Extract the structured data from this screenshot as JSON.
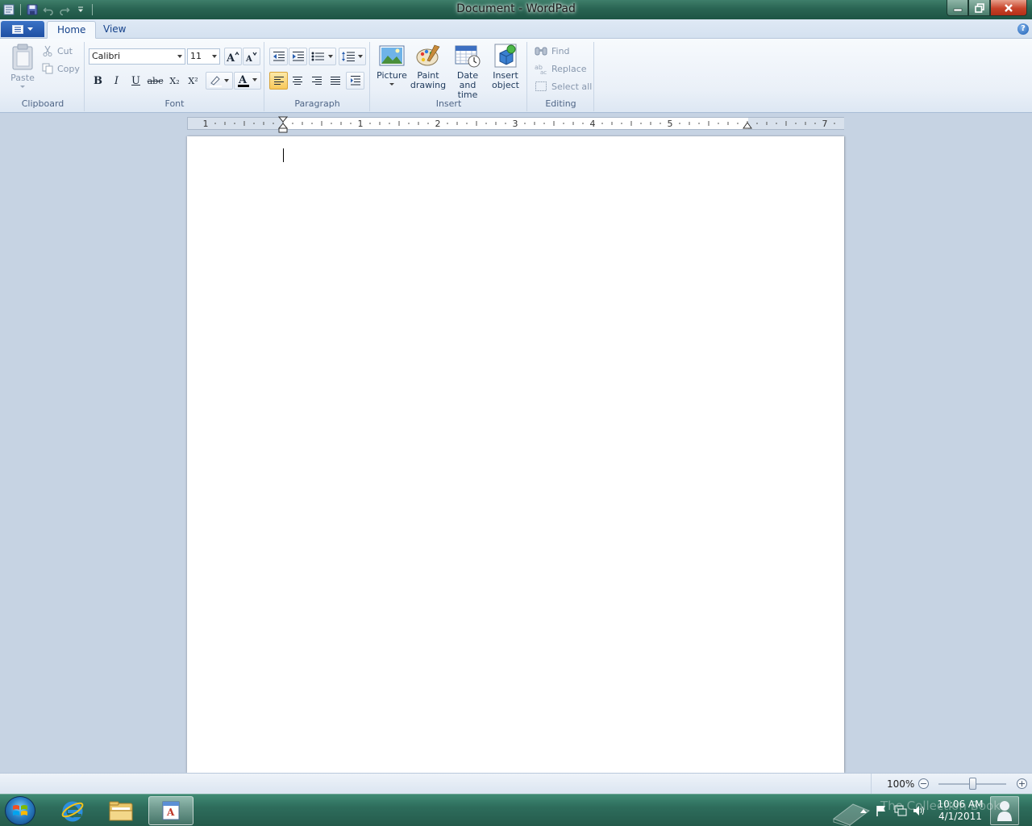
{
  "window": {
    "title": "Document - WordPad"
  },
  "quick_access": {
    "items": [
      "app-icon",
      "save-icon",
      "undo-icon",
      "redo-icon",
      "customize-icon"
    ]
  },
  "ribbon": {
    "tabs": [
      {
        "label": "Home",
        "active": true
      },
      {
        "label": "View",
        "active": false
      }
    ],
    "groups": {
      "clipboard": {
        "label": "Clipboard",
        "paste": "Paste",
        "cut": "Cut",
        "copy": "Copy"
      },
      "font": {
        "label": "Font",
        "family": "Calibri",
        "size": "11",
        "bold": "B",
        "italic": "I",
        "underline": "U",
        "strikethrough": "abc",
        "subscript": "X₂",
        "superscript": "X²"
      },
      "paragraph": {
        "label": "Paragraph"
      },
      "insert": {
        "label": "Insert",
        "picture": "Picture",
        "paint_drawing_1": "Paint",
        "paint_drawing_2": "drawing",
        "date_time_1": "Date and",
        "date_time_2": "time",
        "insert_object_1": "Insert",
        "insert_object_2": "object"
      },
      "editing": {
        "label": "Editing",
        "find": "Find",
        "replace": "Replace",
        "select_all": "Select all"
      }
    }
  },
  "ruler": {
    "labels": [
      "1",
      "1",
      "2",
      "3",
      "4",
      "5",
      "7"
    ]
  },
  "status": {
    "zoom": "100%",
    "zoom_out": "−",
    "zoom_in": "+",
    "zoom_level": 1.0
  },
  "taskbar": {
    "clock_time": "10:06 AM",
    "clock_date": "4/1/2011",
    "watermark": "The Collection Book"
  },
  "colors": {
    "accent": "#15428b",
    "title_bar": "#2a6453",
    "taskbar": "#2e6d5c",
    "font_color": "#000000",
    "highlight": "#f8c85b"
  }
}
